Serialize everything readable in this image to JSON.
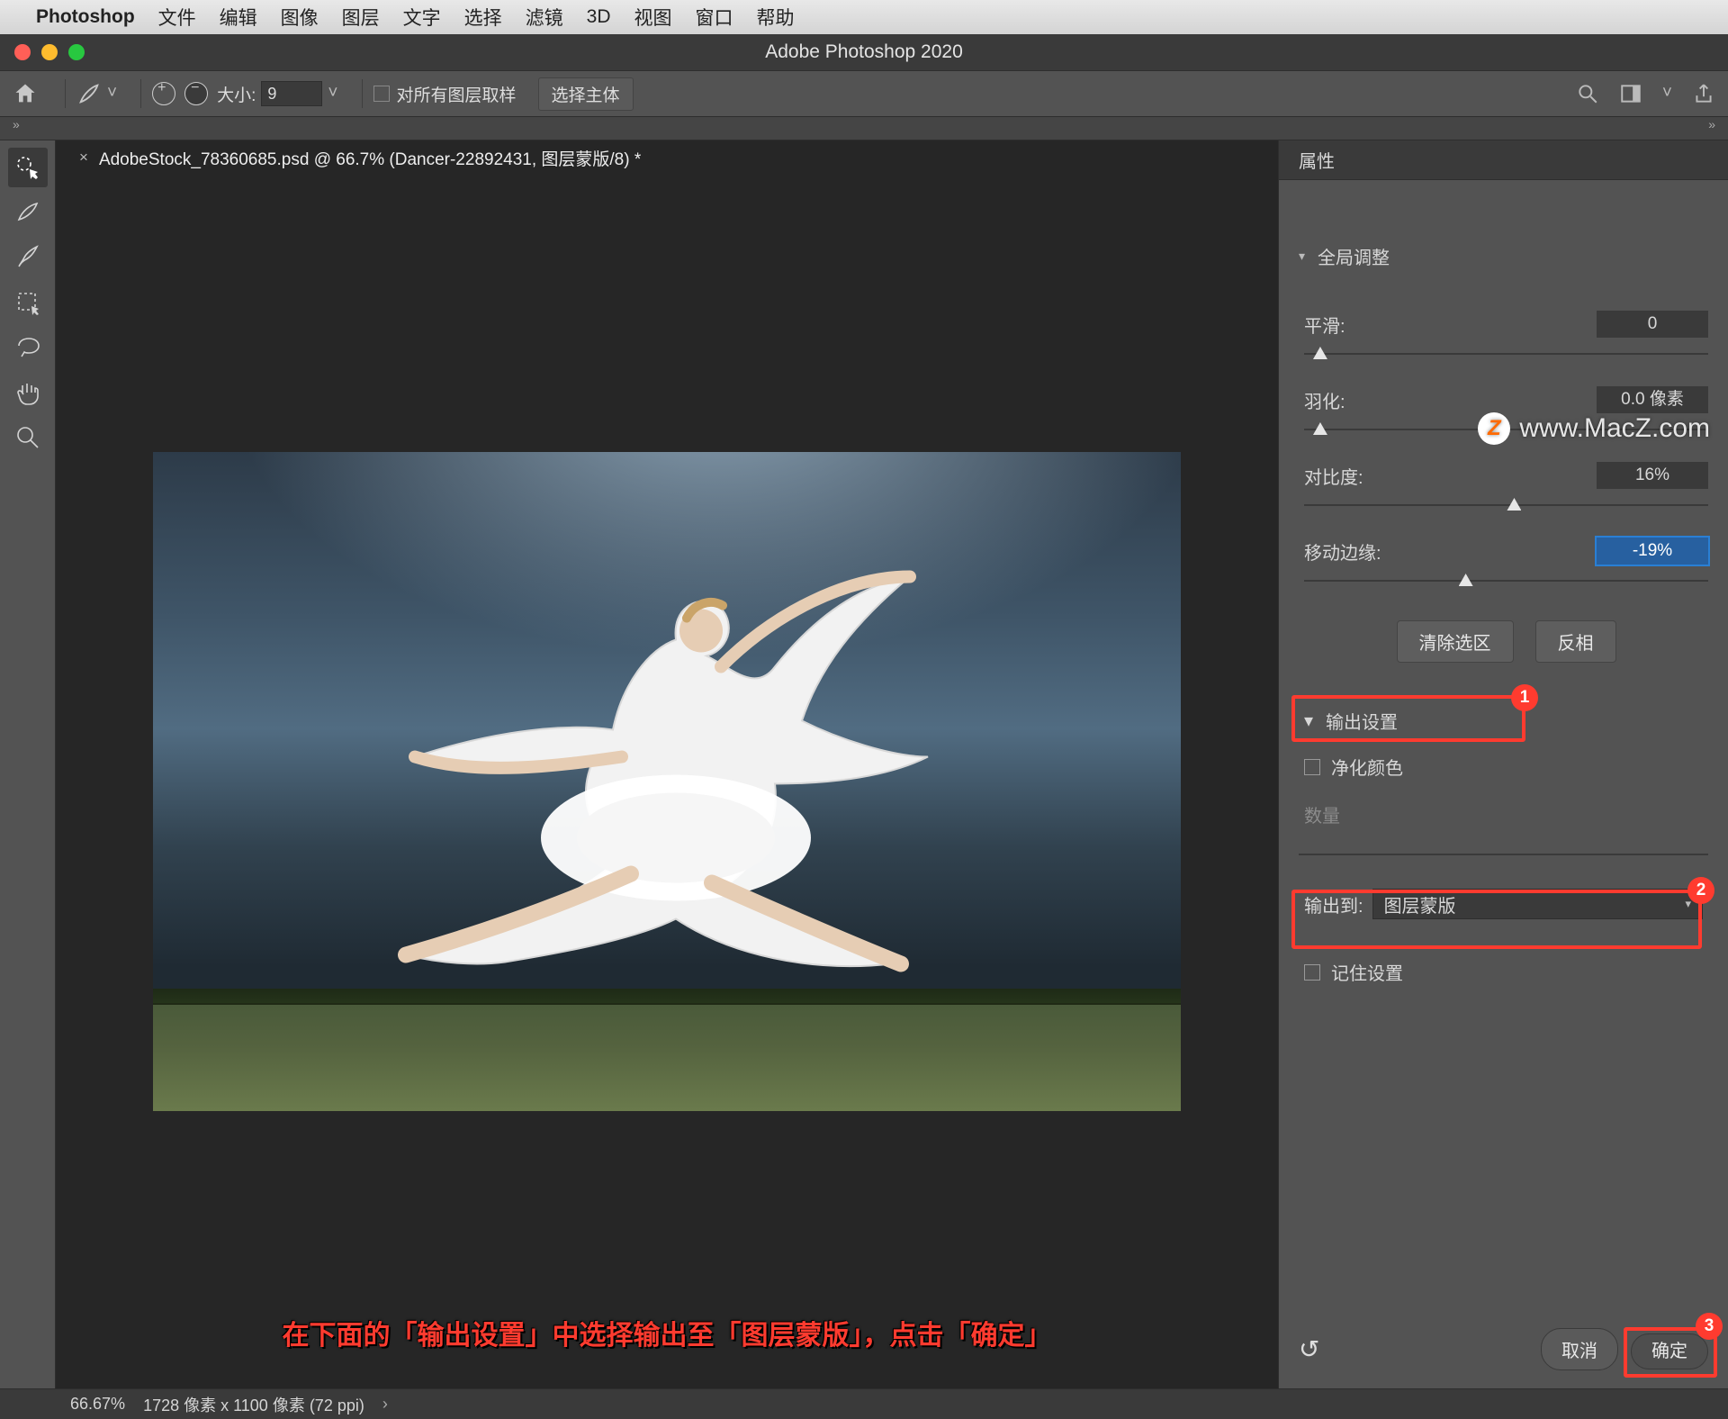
{
  "mac_menu": {
    "app_name": "Photoshop",
    "items": [
      "文件",
      "编辑",
      "图像",
      "图层",
      "文字",
      "选择",
      "滤镜",
      "3D",
      "视图",
      "窗口",
      "帮助"
    ]
  },
  "window": {
    "title": "Adobe Photoshop 2020"
  },
  "options": {
    "size_label": "大小:",
    "size_value": "9",
    "sample_all": "对所有图层取样",
    "select_subject": "选择主体"
  },
  "document": {
    "tab": "AdobeStock_78360685.psd @ 66.7% (Dancer-22892431, 图层蒙版/8) *"
  },
  "tools": [
    "quick-selection",
    "refine-edge-brush",
    "brush",
    "marquee",
    "lasso",
    "hand",
    "zoom"
  ],
  "properties": {
    "tab": "属性",
    "global_title": "全局调整",
    "smooth": {
      "label": "平滑:",
      "value": "0",
      "pos": 4
    },
    "feather": {
      "label": "羽化:",
      "value": "0.0 像素",
      "pos": 4
    },
    "contrast": {
      "label": "对比度:",
      "value": "16%",
      "pos": 52
    },
    "shift": {
      "label": "移动边缘:",
      "value": "-19%",
      "pos": 40
    },
    "clear_btn": "清除选区",
    "invert_btn": "反相"
  },
  "output": {
    "title": "输出设置",
    "decontaminate": "净化颜色",
    "decontaminate_enabled": false,
    "amount_label": "数量",
    "to_label": "输出到:",
    "to_value": "图层蒙版",
    "remember": "记住设置"
  },
  "footer": {
    "cancel": "取消",
    "ok": "确定"
  },
  "caption": "在下面的「输出设置」中选择输出至「图层蒙版」，点击「确定」",
  "status": {
    "zoom": "66.67%",
    "dims": "1728 像素 x 1100 像素 (72 ppi)"
  },
  "watermark": "www.MacZ.com",
  "badges": {
    "b1": "1",
    "b2": "2",
    "b3": "3"
  }
}
